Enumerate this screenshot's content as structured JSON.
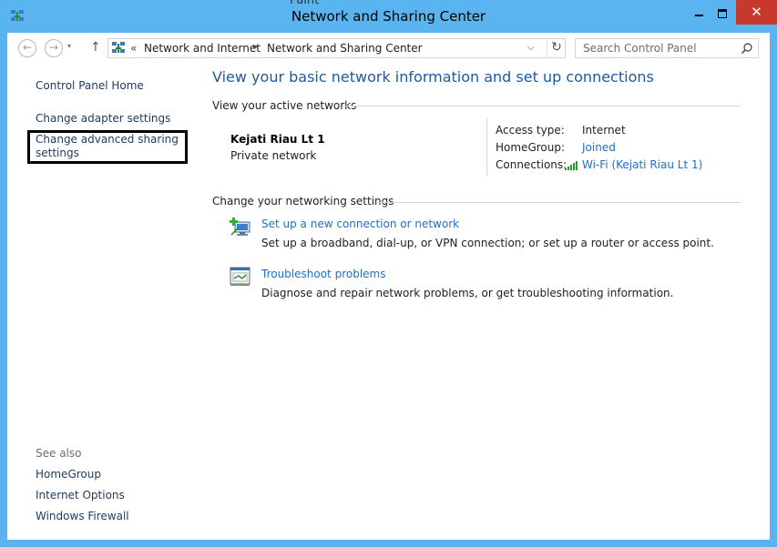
{
  "window": {
    "title": "Network and Sharing Center",
    "background_app_title": "Paint",
    "close_glyph": "✕",
    "app_icon": "network-icon"
  },
  "navigation": {
    "back_glyph": "←",
    "forward_glyph": "→",
    "recent_glyph": "▾",
    "up_glyph": "↑",
    "refresh_glyph": "↻",
    "address": {
      "chevrons": "«",
      "separator": "▸",
      "breadcrumbs": [
        "Network and Internet",
        "Network and Sharing Center"
      ],
      "dropdown_glyph": "⌵"
    },
    "search": {
      "placeholder": "Search Control Panel"
    }
  },
  "sidebar": {
    "links": [
      "Control Panel Home",
      "Change adapter settings",
      "Change advanced sharing settings"
    ],
    "see_also_title": "See also",
    "see_also_links": [
      "HomeGroup",
      "Internet Options",
      "Windows Firewall"
    ]
  },
  "main": {
    "heading": "View your basic network information and set up connections",
    "active_networks": {
      "title": "View your active networks",
      "network_name": "Kejati Riau Lt 1",
      "network_category": "Private network",
      "properties": {
        "access_type_label": "Access type:",
        "access_type_value": "Internet",
        "homegroup_label": "HomeGroup:",
        "homegroup_value": "Joined",
        "connections_label": "Connections:",
        "connections_value": "Wi-Fi (Kejati Riau Lt 1)"
      }
    },
    "networking_settings": {
      "title": "Change your networking settings",
      "tasks": [
        {
          "title": "Set up a new connection or network",
          "description": "Set up a broadband, dial-up, or VPN connection; or set up a router or access point."
        },
        {
          "title": "Troubleshoot problems",
          "description": "Diagnose and repair network problems, or get troubleshooting information."
        }
      ]
    }
  },
  "colors": {
    "window_frame": "#59b3ef",
    "close_button": "#c7392c",
    "link": "#1e6fc8",
    "heading": "#1e5aa0",
    "nav_link": "#1e395b"
  }
}
